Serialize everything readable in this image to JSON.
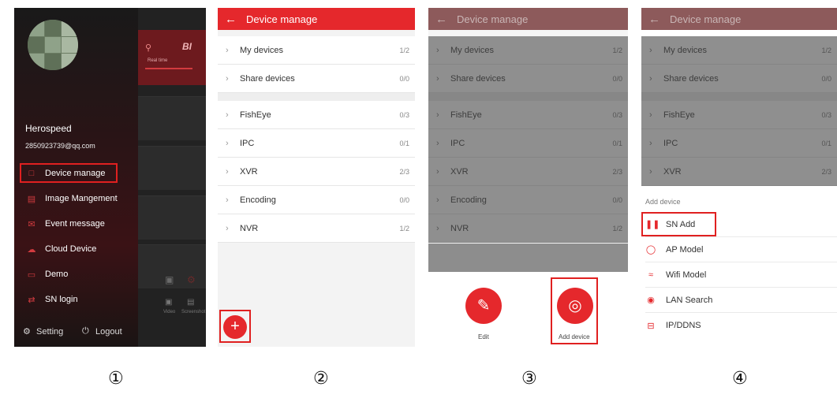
{
  "colors": {
    "accent": "#e5282c",
    "highlight_border": "#e02020",
    "drawer_bg": "#1b1b1b"
  },
  "panel1": {
    "user_name": "Herospeed",
    "email": "2850923739@qq.com",
    "menu": [
      {
        "label": "Device manage",
        "icon": "device-icon"
      },
      {
        "label": "Image Mangement",
        "icon": "image-icon"
      },
      {
        "label": "Event message",
        "icon": "envelope-icon"
      },
      {
        "label": "Cloud Device",
        "icon": "cloud-icon"
      },
      {
        "label": "Demo",
        "icon": "demo-icon"
      },
      {
        "label": "SN login",
        "icon": "login-icon"
      }
    ],
    "footer": {
      "setting": "Setting",
      "logout": "Logout"
    },
    "background_app": {
      "tab": "Real time",
      "brand": "BI",
      "video": "Video",
      "screenshot": "Screenshot"
    }
  },
  "device_manage": {
    "title": "Device manage",
    "groups": [
      [
        {
          "label": "My devices",
          "count": "1/2"
        },
        {
          "label": "Share devices",
          "count": "0/0"
        }
      ],
      [
        {
          "label": "FishEye",
          "count": "0/3"
        },
        {
          "label": "IPC",
          "count": "0/1"
        },
        {
          "label": "XVR",
          "count": "2/3"
        },
        {
          "label": "Encoding",
          "count": "0/0"
        },
        {
          "label": "NVR",
          "count": "1/2"
        }
      ]
    ],
    "fab": "+"
  },
  "panel3": {
    "edit": "Edit",
    "add_device": "Add device"
  },
  "panel4": {
    "sheet_title": "Add device",
    "options": [
      {
        "label": "SN Add",
        "icon": "barcode-icon"
      },
      {
        "label": "AP Model",
        "icon": "ap-icon"
      },
      {
        "label": "Wifi Model",
        "icon": "wifi-icon"
      },
      {
        "label": "LAN Search",
        "icon": "location-icon"
      },
      {
        "label": "IP/DDNS",
        "icon": "ip-icon"
      }
    ]
  },
  "step_numbers": [
    "①",
    "②",
    "③",
    "④"
  ]
}
